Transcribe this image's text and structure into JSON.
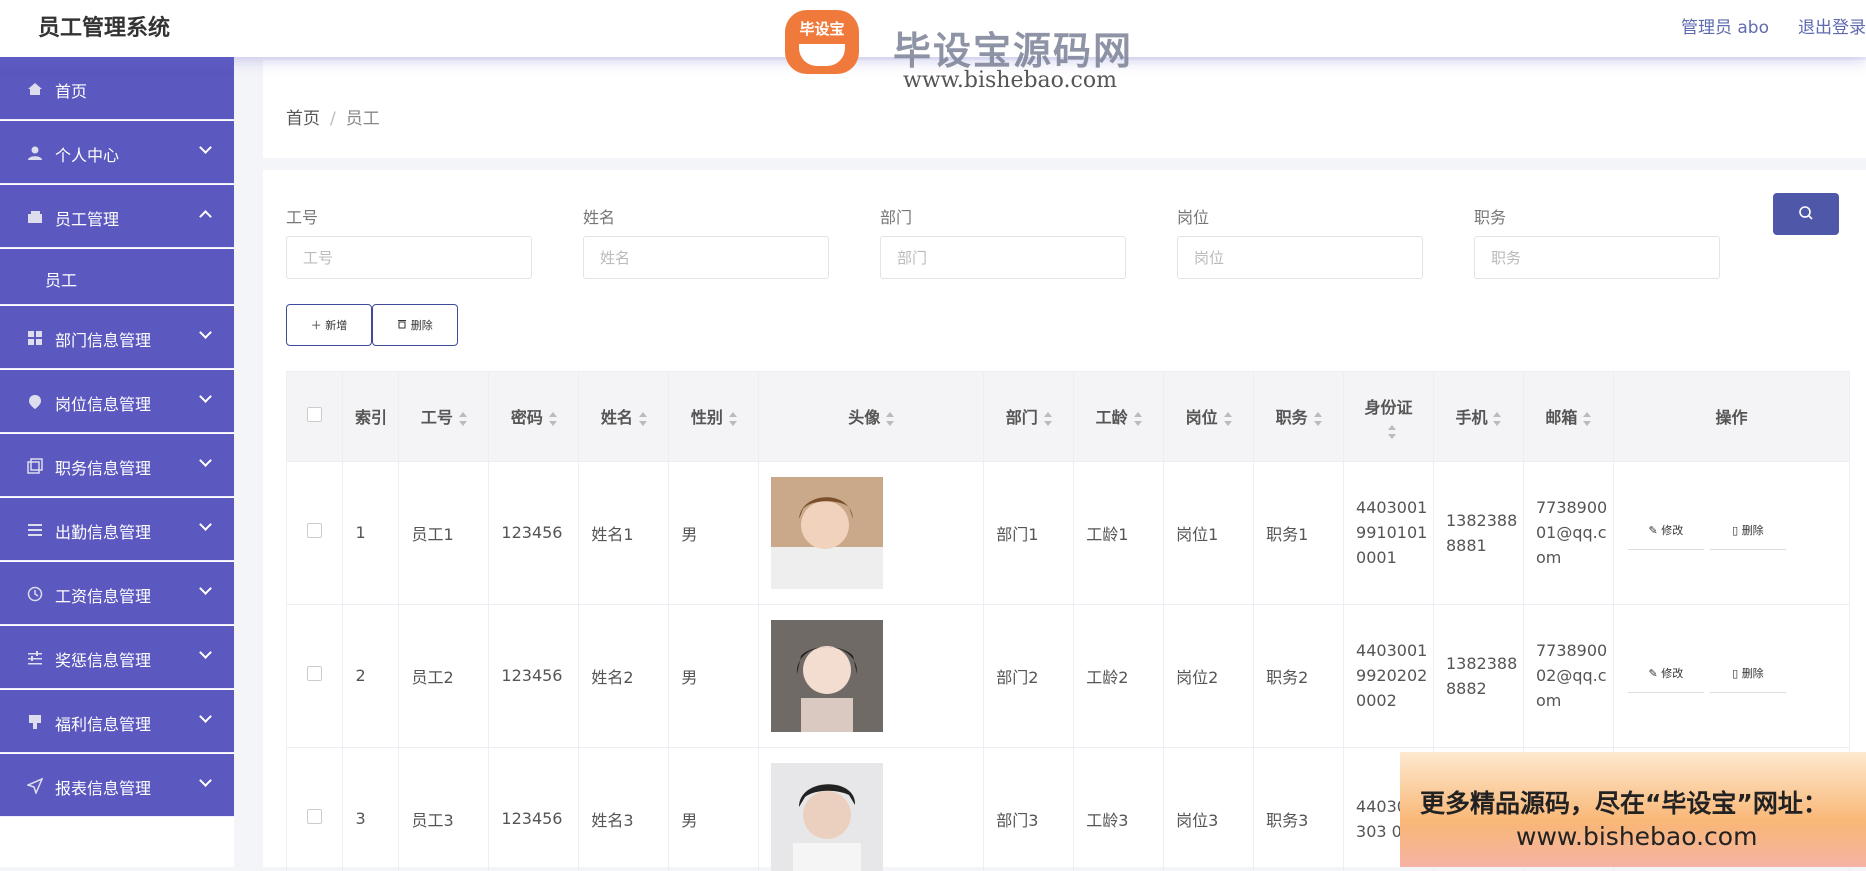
{
  "header": {
    "app_title": "员工管理系统",
    "user": "管理员 abo",
    "logout": "退出登录"
  },
  "watermark": {
    "badge": "毕设宝",
    "title": "毕设宝源码网",
    "url": "www.bishebao.com"
  },
  "sidebar": {
    "items": [
      {
        "label": "首页",
        "icon": "home-icon"
      },
      {
        "label": "个人中心",
        "icon": "user-icon"
      },
      {
        "label": "员工管理",
        "icon": "wallet-icon",
        "expanded": true,
        "sub": "员工"
      },
      {
        "label": "部门信息管理",
        "icon": "grid-icon"
      },
      {
        "label": "岗位信息管理",
        "icon": "location-icon"
      },
      {
        "label": "职务信息管理",
        "icon": "copy-icon"
      },
      {
        "label": "出勤信息管理",
        "icon": "list-icon"
      },
      {
        "label": "工资信息管理",
        "icon": "clock-icon"
      },
      {
        "label": "奖惩信息管理",
        "icon": "sliders-icon"
      },
      {
        "label": "福利信息管理",
        "icon": "stamp-icon"
      },
      {
        "label": "报表信息管理",
        "icon": "send-icon"
      }
    ]
  },
  "breadcrumb": {
    "home": "首页",
    "current": "员工"
  },
  "filters": [
    {
      "label": "工号",
      "placeholder": "工号"
    },
    {
      "label": "姓名",
      "placeholder": "姓名"
    },
    {
      "label": "部门",
      "placeholder": "部门"
    },
    {
      "label": "岗位",
      "placeholder": "岗位"
    },
    {
      "label": "职务",
      "placeholder": "职务"
    }
  ],
  "actions": {
    "add": "＋ 新增",
    "delete": "删除"
  },
  "table": {
    "columns": [
      "索引",
      "工号",
      "密码",
      "姓名",
      "性别",
      "头像",
      "部门",
      "工龄",
      "岗位",
      "职务",
      "身份证",
      "手机",
      "邮箱",
      "操作"
    ],
    "rows": [
      {
        "index": "1",
        "no": "员工1",
        "pwd": "123456",
        "name": "姓名1",
        "sex": "男",
        "dept": "部门1",
        "years": "工龄1",
        "post": "岗位1",
        "duty": "职务1",
        "idcard": "440300199101010001",
        "phone": "13823888881",
        "email": "773890001@qq.com"
      },
      {
        "index": "2",
        "no": "员工2",
        "pwd": "123456",
        "name": "姓名2",
        "sex": "男",
        "dept": "部门2",
        "years": "工龄2",
        "post": "岗位2",
        "duty": "职务2",
        "idcard": "440300199202020002",
        "phone": "13823888882",
        "email": "773890002@qq.com"
      },
      {
        "index": "3",
        "no": "员工3",
        "pwd": "123456",
        "name": "姓名3",
        "sex": "男",
        "dept": "部门3",
        "years": "工龄3",
        "post": "岗位3",
        "duty": "职务3",
        "idcard": "44030 99303 0003",
        "phone": "",
        "email": ""
      }
    ],
    "op_edit": "修改",
    "op_delete": "删除"
  },
  "promo": {
    "line1": "更多精品源码，尽在“毕设宝”网址：",
    "line2": "www.bishebao.com"
  },
  "colors": {
    "sidebar": "#5b59bf",
    "primary": "#4e57a8",
    "accent": "#f07a3c"
  }
}
